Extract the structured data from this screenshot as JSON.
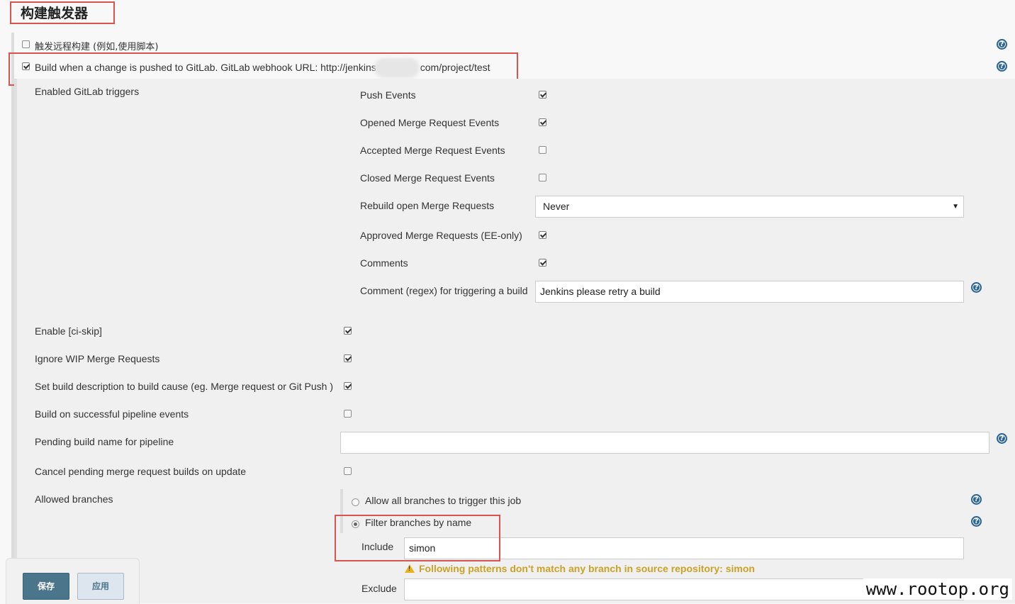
{
  "section": {
    "title": "构建触发器"
  },
  "remote_trigger": {
    "label": "触发远程构建 (例如,使用脚本)",
    "checked": false
  },
  "gitlab_trigger": {
    "label_prefix": "Build when a change is pushed to GitLab. GitLab webhook URL: http://jenkins",
    "label_suffix": "com/project/test",
    "checked": true
  },
  "enabled_triggers": {
    "label": "Enabled GitLab triggers",
    "push_events": {
      "label": "Push Events",
      "checked": true
    },
    "opened_mr": {
      "label": "Opened Merge Request Events",
      "checked": true
    },
    "accepted_mr": {
      "label": "Accepted Merge Request Events",
      "checked": false
    },
    "closed_mr": {
      "label": "Closed Merge Request Events",
      "checked": false
    },
    "rebuild_open_mr": {
      "label": "Rebuild open Merge Requests",
      "value": "Never"
    },
    "approved_mr": {
      "label": "Approved Merge Requests (EE-only)",
      "checked": true
    },
    "comments": {
      "label": "Comments",
      "checked": true
    },
    "comment_regex": {
      "label": "Comment (regex) for triggering a build",
      "value": "Jenkins please retry a build"
    }
  },
  "options": {
    "ci_skip": {
      "label": "Enable [ci-skip]",
      "checked": true
    },
    "ignore_wip": {
      "label": "Ignore WIP Merge Requests",
      "checked": true
    },
    "set_description": {
      "label": "Set build description to build cause (eg. Merge request or Git Push )",
      "checked": true
    },
    "pipeline_events": {
      "label": "Build on successful pipeline events",
      "checked": false
    },
    "pending_build_name": {
      "label": "Pending build name for pipeline",
      "value": ""
    },
    "cancel_pending": {
      "label": "Cancel pending merge request builds on update",
      "checked": false
    }
  },
  "allowed_branches": {
    "label": "Allowed branches",
    "allow_all": {
      "label": "Allow all branches to trigger this job",
      "selected": false
    },
    "filter_by_name": {
      "label": "Filter branches by name",
      "selected": true
    },
    "include": {
      "label": "Include",
      "value": "simon"
    },
    "warning": "Following patterns don't match any branch in source repository: simon",
    "exclude": {
      "label": "Exclude",
      "value": ""
    }
  },
  "buttons": {
    "save": "保存",
    "apply": "应用"
  },
  "watermark": "www.rootop.org",
  "help_glyph": "?",
  "colors": {
    "highlight_border": "#d9534f",
    "save_button": "#4b758b",
    "warning_text": "#c9a227",
    "help_icon": "#2a6496"
  }
}
